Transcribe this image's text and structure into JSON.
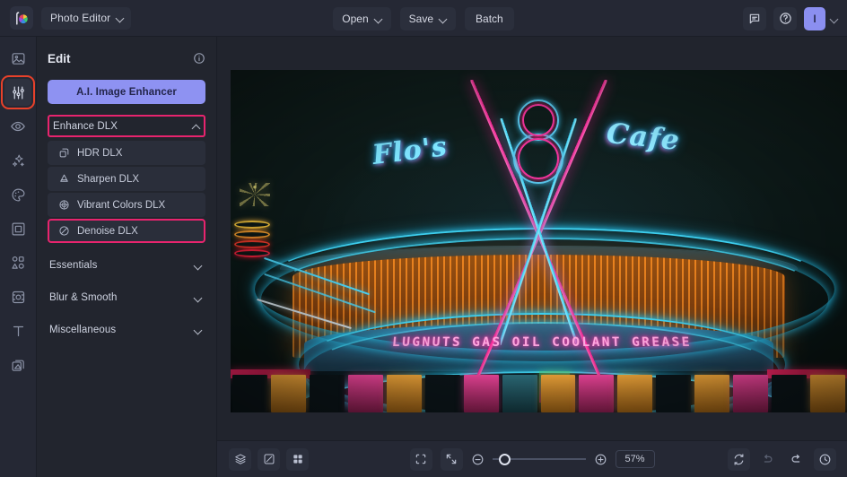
{
  "app": {
    "logo_icon": "color-wheel-logo-icon",
    "workspace_label": "Photo Editor"
  },
  "topbar": {
    "open_label": "Open",
    "save_label": "Save",
    "batch_label": "Batch",
    "feedback_icon": "comment-icon",
    "help_icon": "question-circle-icon",
    "avatar_initial": "I"
  },
  "rail": {
    "items": [
      {
        "icon": "image-icon",
        "name": "image",
        "active": false
      },
      {
        "icon": "sliders-icon",
        "name": "adjust",
        "active": true
      },
      {
        "icon": "eye-icon",
        "name": "retouch",
        "active": false
      },
      {
        "icon": "sparkles-icon",
        "name": "effects",
        "active": false
      },
      {
        "icon": "palette-icon",
        "name": "color",
        "active": false
      },
      {
        "icon": "frame-icon",
        "name": "frames",
        "active": false
      },
      {
        "icon": "shapes-icon",
        "name": "shapes",
        "active": false
      },
      {
        "icon": "ai-crop-icon",
        "name": "ai-tools",
        "active": false
      },
      {
        "icon": "text-icon",
        "name": "text",
        "active": false
      },
      {
        "icon": "layers-copy-icon",
        "name": "layers",
        "active": false
      }
    ]
  },
  "panel": {
    "title": "Edit",
    "info_icon": "info-circle-icon",
    "ai_enhancer_label": "A.I. Image Enhancer",
    "enhance_group": {
      "label": "Enhance DLX",
      "expanded": true,
      "chevron_icon": "chevron-up-icon",
      "highlight_color": "#e8246e",
      "items": [
        {
          "label": "HDR DLX",
          "icon": "cube-icon",
          "highlighted": false
        },
        {
          "label": "Sharpen DLX",
          "icon": "cone-icon",
          "highlighted": false
        },
        {
          "label": "Vibrant Colors DLX",
          "icon": "vibrant-circle-icon",
          "highlighted": false
        },
        {
          "label": "Denoise DLX",
          "icon": "no-noise-icon",
          "highlighted": true
        }
      ]
    },
    "collapsed_groups": [
      {
        "label": "Essentials",
        "chevron_icon": "chevron-down-icon"
      },
      {
        "label": "Blur & Smooth",
        "chevron_icon": "chevron-down-icon"
      },
      {
        "label": "Miscellaneous",
        "chevron_icon": "chevron-down-icon"
      }
    ]
  },
  "photo": {
    "description": "Night photo of a neon diner sign",
    "neon_texts": {
      "left_script": "Flo's",
      "right_script": "Cafe",
      "emblem": "V8",
      "marquee": "LUGNUTS GAS OIL COOLANT GREASE"
    }
  },
  "bottombar": {
    "left_icons": [
      {
        "icon": "layers-stack-icon",
        "name": "layers-panel"
      },
      {
        "icon": "compare-split-icon",
        "name": "compare-view"
      },
      {
        "icon": "grid-four-icon",
        "name": "grid-view"
      }
    ],
    "fit_icon": "fit-frame-icon",
    "actual_size_icon": "collapse-arrows-icon",
    "zoom_out_icon": "minus-circle-icon",
    "zoom_in_icon": "plus-circle-icon",
    "zoom_value": "57%",
    "right_icons": [
      {
        "icon": "reset-refresh-icon",
        "name": "reset"
      },
      {
        "icon": "undo-arrow-icon",
        "name": "undo",
        "disabled": true
      },
      {
        "icon": "redo-arrow-icon",
        "name": "redo",
        "disabled": false
      },
      {
        "icon": "history-clock-icon",
        "name": "history"
      }
    ]
  },
  "colors": {
    "accent_purple": "#8e92f2",
    "highlight_pink": "#e8246e",
    "highlight_red": "#e8412a",
    "panel_bg": "#22252e",
    "bar_bg": "#252834"
  }
}
